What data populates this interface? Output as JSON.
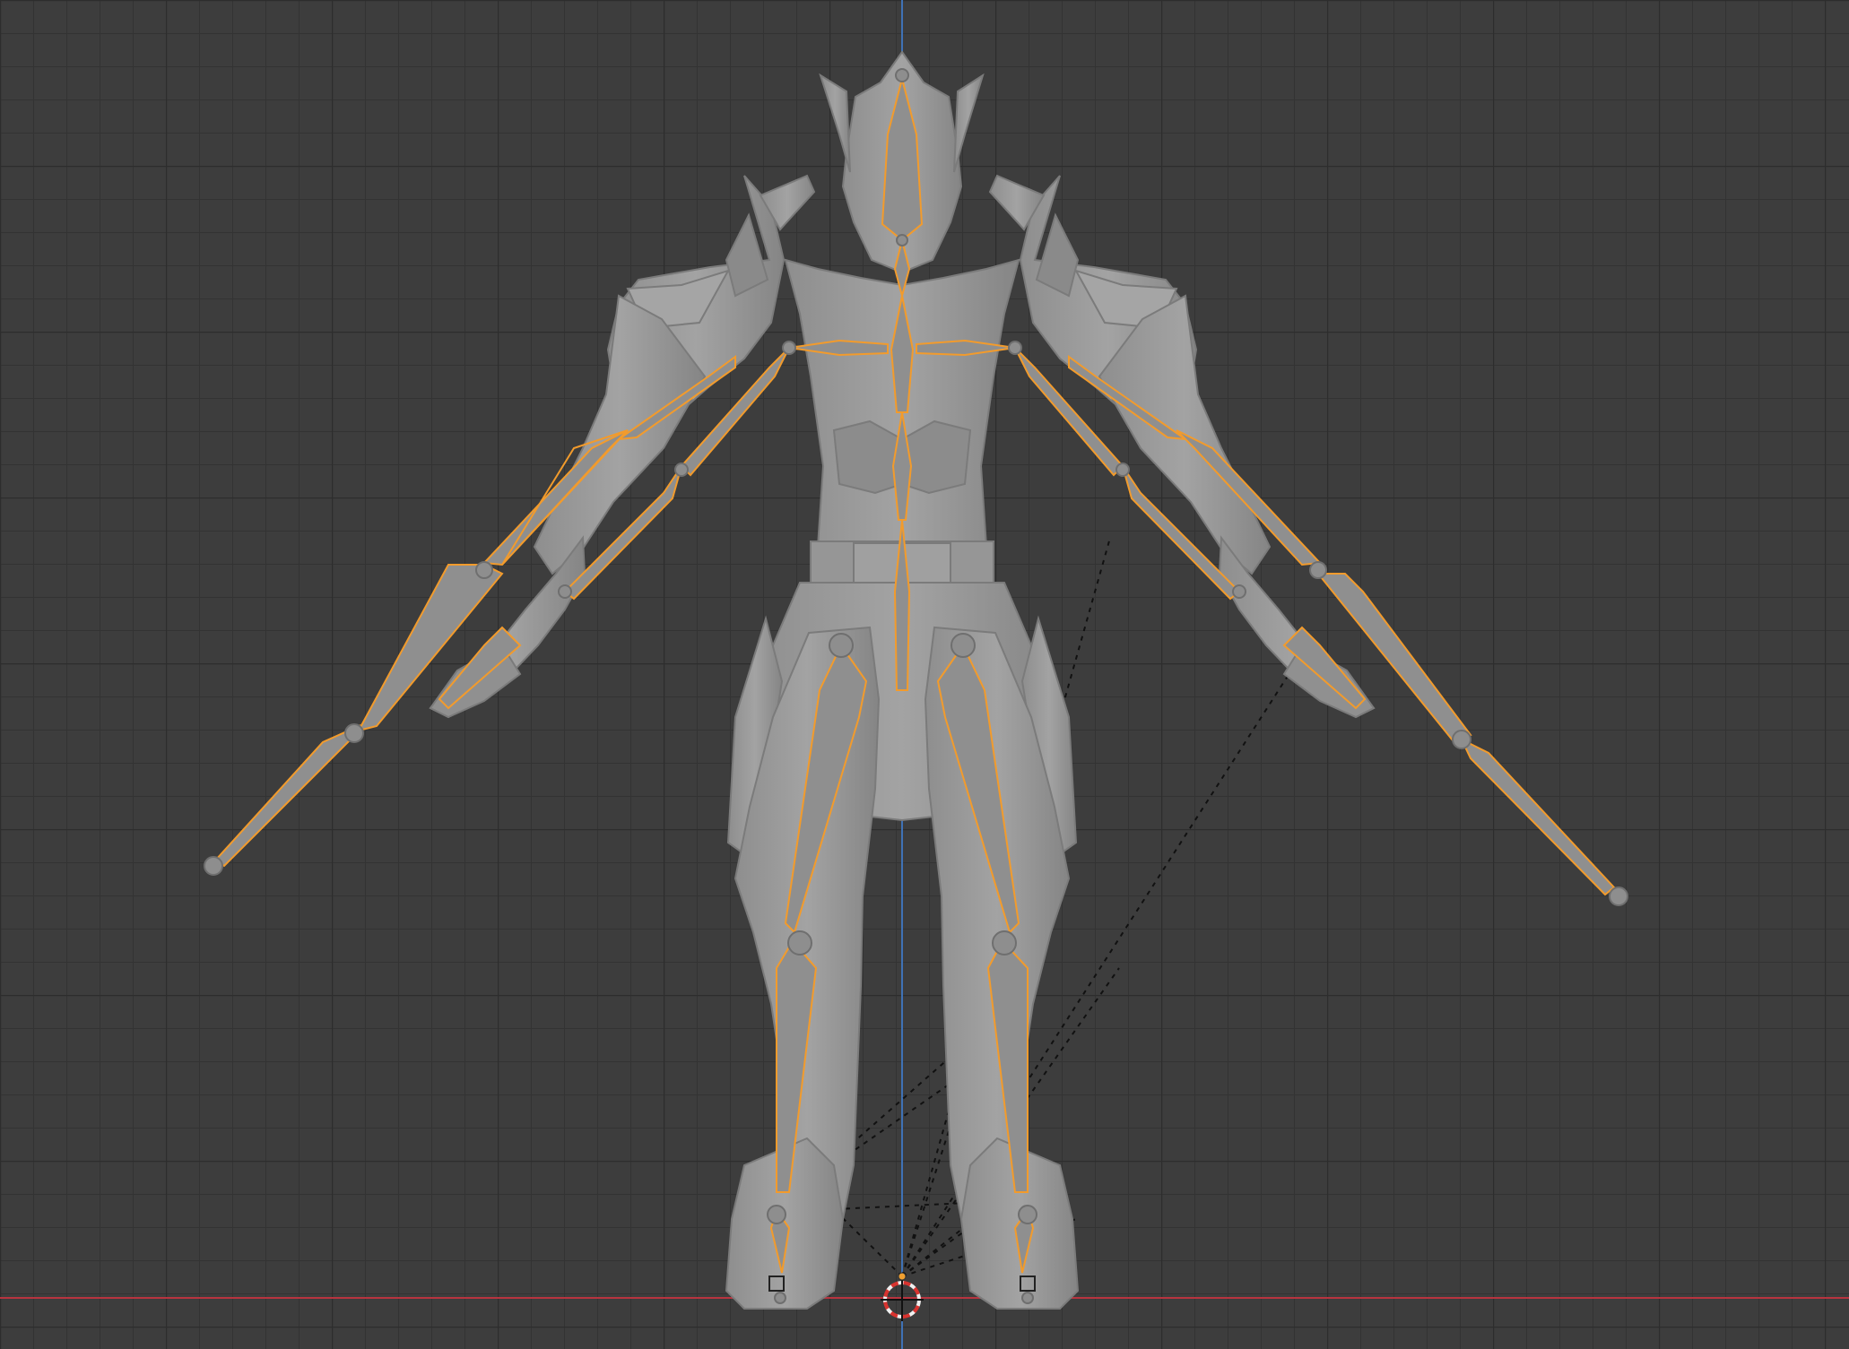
{
  "viewport": {
    "background": "#3d3d3d",
    "grid_minor_color": "#333333",
    "grid_major_color": "#2e2e2e",
    "axis_x_color": "#b8343f",
    "axis_z_color": "#3f72b5",
    "model_color": "#9a9a9a",
    "model_shadow": "#7c7c7c",
    "bone_color": "#8f8f8f",
    "bone_outline": "#f29b2c",
    "relationship_line": "#111111",
    "cursor_red": "#d8332f",
    "cursor_white": "#f0f0f0"
  },
  "scene": {
    "object": "armature-with-armored-character-mesh",
    "view": "front-orthographic",
    "mode": "bone-display",
    "icons": [
      "3d-cursor-icon",
      "origin-icon"
    ]
  }
}
